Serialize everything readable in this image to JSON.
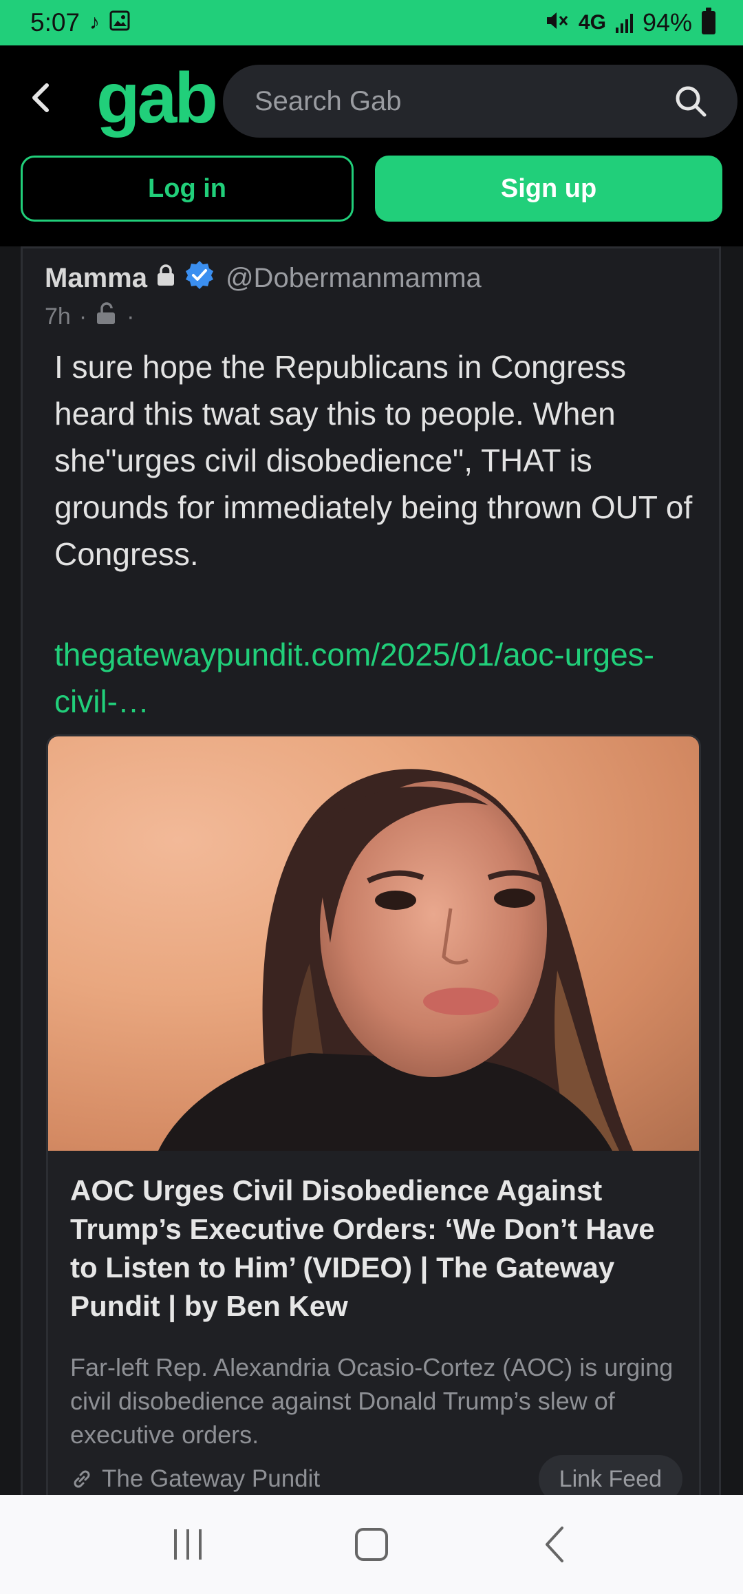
{
  "status_bar": {
    "time": "5:07",
    "network": "4G",
    "battery": "94%",
    "icons": [
      "tiktok-icon",
      "image-icon",
      "mute-icon",
      "signal-icon",
      "battery-icon"
    ]
  },
  "header": {
    "logo": "gab",
    "search_placeholder": "Search Gab",
    "login_label": "Log in",
    "signup_label": "Sign up"
  },
  "post": {
    "author": "Mamma",
    "handle": "@Dobermanmamma",
    "time": "7h",
    "text": "I sure hope the Republicans in Congress heard this twat say this to people. When she\"urges civil disobedience\", THAT is grounds for immediately being thrown OUT of Congress.",
    "link": "thegatewaypundit.com/2025/01/aoc-urges-civil-…",
    "card": {
      "title": "AOC Urges Civil Disobedience Against Trump’s Executive Orders: ‘We Don’t Have to Listen to Him’ (VIDEO) | The Gateway Pundit | by Ben Kew",
      "description": "Far-left Rep. Alexandria Ocasio-Cortez (AOC) is urging civil disobedience against Donald Trump’s slew of executive orders.",
      "source": "The Gateway Pundit",
      "link_feed_label": "Link Feed"
    }
  },
  "colors": {
    "brand": "#21cf7a",
    "background": "#1c1d21",
    "verified": "#3b8ff0"
  }
}
